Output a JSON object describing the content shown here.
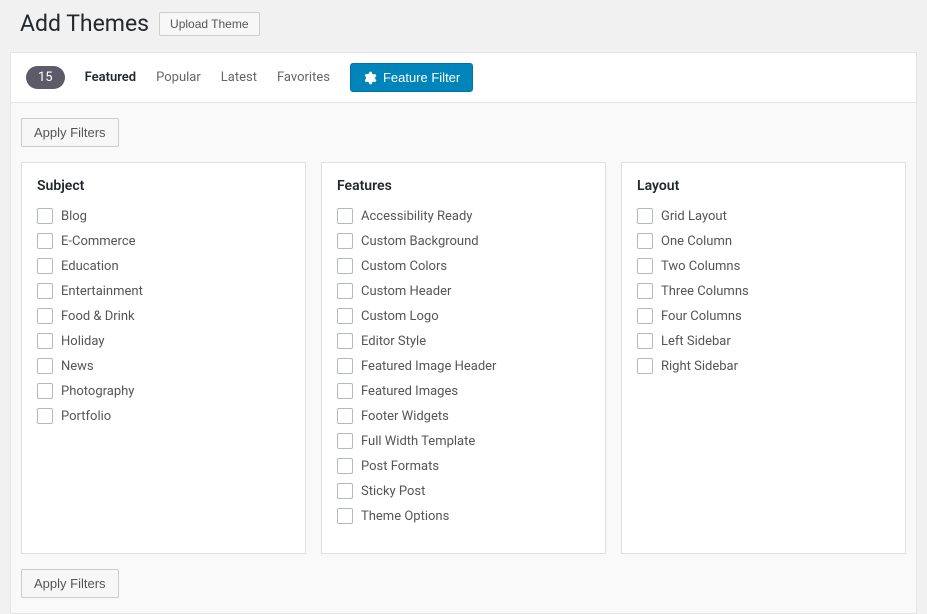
{
  "header": {
    "title": "Add Themes",
    "upload_label": "Upload Theme"
  },
  "filter_bar": {
    "count": "15",
    "tabs": [
      {
        "label": "Featured",
        "active": true
      },
      {
        "label": "Popular",
        "active": false
      },
      {
        "label": "Latest",
        "active": false
      },
      {
        "label": "Favorites",
        "active": false
      }
    ],
    "feature_filter_label": "Feature Filter"
  },
  "apply_filters_label": "Apply Filters",
  "columns": {
    "subject": {
      "title": "Subject",
      "items": [
        "Blog",
        "E-Commerce",
        "Education",
        "Entertainment",
        "Food & Drink",
        "Holiday",
        "News",
        "Photography",
        "Portfolio"
      ]
    },
    "features": {
      "title": "Features",
      "items": [
        "Accessibility Ready",
        "Custom Background",
        "Custom Colors",
        "Custom Header",
        "Custom Logo",
        "Editor Style",
        "Featured Image Header",
        "Featured Images",
        "Footer Widgets",
        "Full Width Template",
        "Post Formats",
        "Sticky Post",
        "Theme Options"
      ]
    },
    "layout": {
      "title": "Layout",
      "items": [
        "Grid Layout",
        "One Column",
        "Two Columns",
        "Three Columns",
        "Four Columns",
        "Left Sidebar",
        "Right Sidebar"
      ]
    }
  }
}
